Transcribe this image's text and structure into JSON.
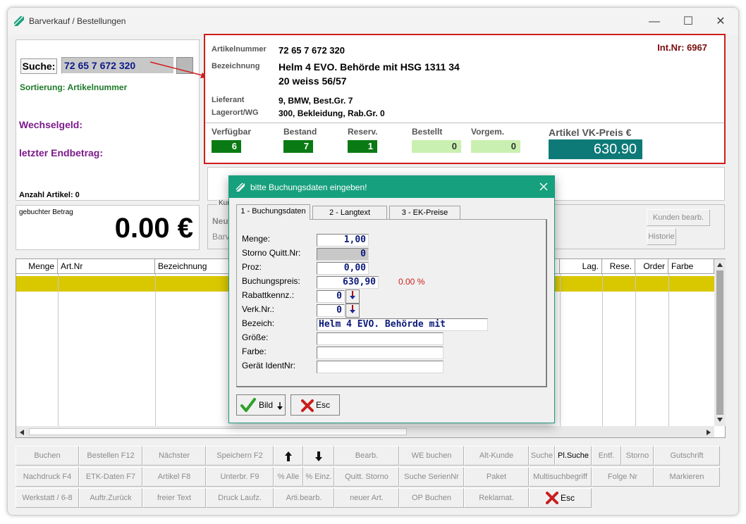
{
  "window": {
    "title": "Barverkauf / Bestellungen",
    "minimize": "—",
    "maximize": "☐",
    "close": "✕"
  },
  "search": {
    "label": "Suche:",
    "value": "72 65 7 672 320",
    "sort": "Sortierung: Artikelnummer"
  },
  "left": {
    "wechselgeld": "Wechselgeld:",
    "endbetrag": "letzter Endbetrag:",
    "anzahl": "Anzahl Artikel: 0",
    "gebuchter_label": "gebuchter Betrag",
    "gebuchter_value": "0.00 €"
  },
  "article": {
    "artnr_label": "Artikelnummer",
    "artnr": "72 65 7 672 320",
    "intnr": "Int.Nr: 6967",
    "bez_label": "Bezeichnung",
    "bez1": "Helm 4 EVO. Behörde mit HSG 1311 34",
    "bez2": "20 weiss 56/57",
    "lief_label": "Lieferant",
    "lief": "9, BMW, Best.Gr. 7",
    "lager_label": "Lagerort/WG",
    "lager": "300, Bekleidung, Rab.Gr. 0",
    "verf_label": "Verfügbar",
    "verf": "6",
    "best_label": "Bestand",
    "best": "7",
    "res_label": "Reserv.",
    "res": "1",
    "bestellt_label": "Bestellt",
    "bestellt": "0",
    "vorg_label": "Vorgem.",
    "vorg": "0",
    "vk_label": "Artikel VK-Preis €",
    "vk": "630.90"
  },
  "kunde": {
    "group": "Kun",
    "row1": "Neut",
    "row2": "Barv",
    "edit_btn": "Kunden bearb.",
    "hist_btn": "Historie"
  },
  "table": {
    "headers": [
      "Menge",
      "Art.Nr",
      "Bezeichnung",
      "Lag.",
      "Rese.",
      "Order",
      "Farbe"
    ]
  },
  "dialog": {
    "title": "bitte Buchungsdaten eingeben!",
    "tabs": [
      "1 - Buchungsdaten",
      "2 - Langtext",
      "3 - EK-Preise"
    ],
    "fields": {
      "menge_label": "Menge:",
      "menge": "1,00",
      "storno_label": "Storno Quitt.Nr:",
      "storno": "0",
      "proz_label": "Proz:",
      "proz": "0,00",
      "preis_label": "Buchungspreis:",
      "preis": "630,90",
      "preis_pct": "0.00 %",
      "rabatt_label": "Rabattkennz.:",
      "rabatt": "0",
      "verk_label": "Verk.Nr.:",
      "verk": "0",
      "bezeich_label": "Bezeich:",
      "bezeich": "Helm 4 EVO. Behörde mit",
      "groesse_label": "Größe:",
      "groesse": "",
      "farbe_label": "Farbe:",
      "farbe": "",
      "geraet_label": "Gerät IdentNr:",
      "geraet": ""
    },
    "bild_btn": "Bild",
    "esc_btn": "Esc"
  },
  "toolbar": {
    "row1": [
      "Buchen",
      "Bestellen F12",
      "Nächster",
      "Speichern F2",
      "Bearb.",
      "WE buchen",
      "Alt-Kunde",
      "Suche",
      "Pl.Suche",
      "Entf.",
      "Storno",
      "Gutschrift"
    ],
    "row2": [
      "Nachdruck F4",
      "ETK-Daten F7",
      "Artikel F8",
      "Unterbr. F9",
      "% Alle",
      "% Einz.",
      "Quitt. Storno",
      "Suche SerienNr",
      "Paket",
      "Multisuchbegriff",
      "Folge Nr",
      "Markieren"
    ],
    "row3": [
      "Werkstatt / 6-8",
      "Auftr.Zurück",
      "freier Text",
      "Druck Laufz.",
      "Arti.bearb.",
      "neuer Art.",
      "OP Buchen",
      "Reklamat.",
      "Esc"
    ]
  },
  "colors": {
    "accent": "#17a07e",
    "highlight_row": "#d9c800",
    "red_border": "#d01c1c",
    "vk_bg": "#0e7a78"
  }
}
